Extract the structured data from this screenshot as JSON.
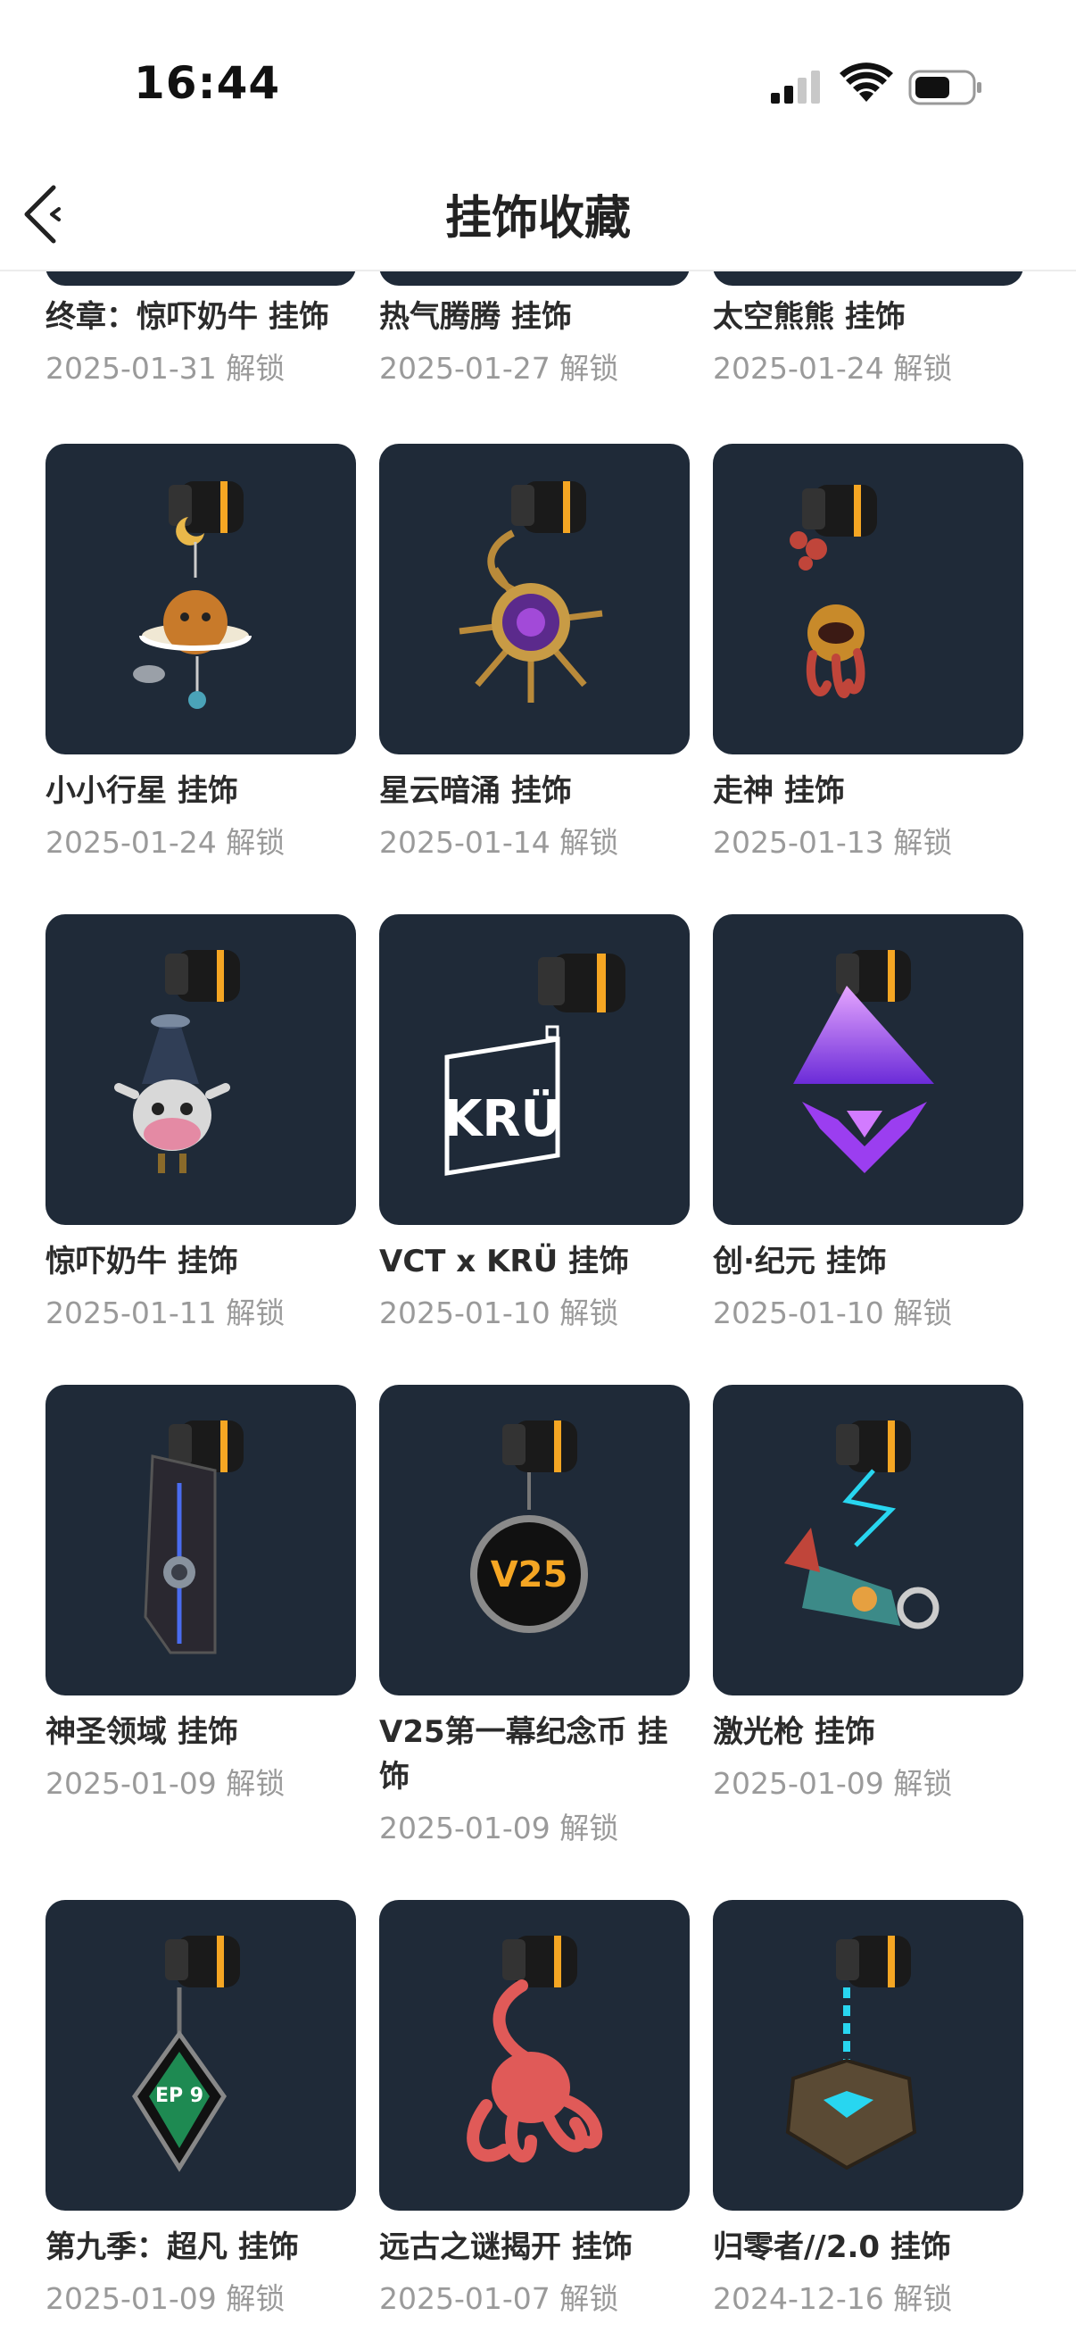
{
  "status_bar": {
    "time": "16:44"
  },
  "header": {
    "title": "挂饰收藏"
  },
  "unlock_suffix": "解锁",
  "rows": [
    [
      {
        "name": "终章：惊吓奶牛 挂饰",
        "date": "2025-01-31 解锁"
      },
      {
        "name": "热气腾腾 挂饰",
        "date": "2025-01-27 解锁"
      },
      {
        "name": "太空熊熊 挂饰",
        "date": "2025-01-24 解锁"
      }
    ],
    [
      {
        "name": "小小行星 挂饰",
        "date": "2025-01-24 解锁",
        "icon": "planet-charm-icon"
      },
      {
        "name": "星云暗涌 挂饰",
        "date": "2025-01-14 解锁",
        "icon": "nebula-charm-icon"
      },
      {
        "name": "走神 挂饰",
        "date": "2025-01-13 解锁",
        "icon": "daydream-charm-icon"
      }
    ],
    [
      {
        "name": "惊吓奶牛 挂饰",
        "date": "2025-01-11 解锁",
        "icon": "cow-charm-icon"
      },
      {
        "name": "VCT x KRÜ 挂饰",
        "date": "2025-01-10 解锁",
        "icon": "kru-logo-charm-icon"
      },
      {
        "name": "创·纪元 挂饰",
        "date": "2025-01-10 解锁",
        "icon": "genesis-charm-icon"
      }
    ],
    [
      {
        "name": "神圣领域 挂饰",
        "date": "2025-01-09 解锁",
        "icon": "sanctum-charm-icon"
      },
      {
        "name": "V25第一幕纪念币 挂饰",
        "date": "2025-01-09 解锁",
        "icon": "v25-coin-charm-icon"
      },
      {
        "name": "激光枪 挂饰",
        "date": "2025-01-09 解锁",
        "icon": "laser-gun-charm-icon"
      }
    ],
    [
      {
        "name": "第九季：超凡 挂饰",
        "date": "2025-01-09 解锁",
        "icon": "ep9-charm-icon",
        "badge": "EP 9"
      },
      {
        "name": "远古之谜揭开 挂饰",
        "date": "2025-01-07 解锁",
        "icon": "octopus-charm-icon"
      },
      {
        "name": "归零者//2.0 挂饰",
        "date": "2024-12-16 解锁",
        "icon": "reaver-charm-icon"
      }
    ]
  ],
  "kru_logo_text": "KRÜ",
  "v25_coin_text": "V25",
  "colors": {
    "tile_bg": "#1f2a38",
    "accent_orange": "#f5a623",
    "text_primary": "#2b2b2b",
    "text_secondary": "#9a9a9a"
  }
}
